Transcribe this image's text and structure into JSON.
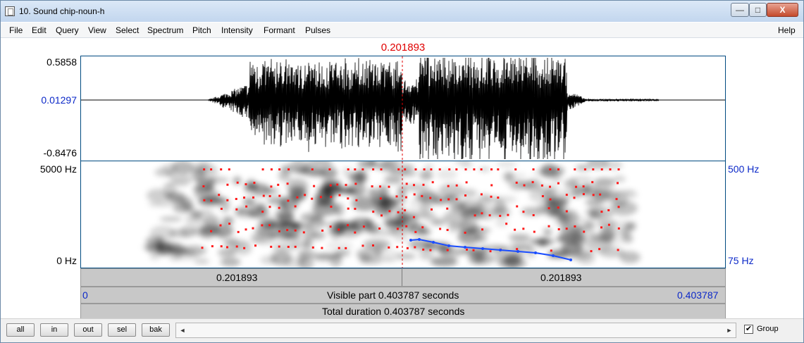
{
  "window": {
    "title": "10. Sound chip-noun-h",
    "controls": {
      "minimize": "—",
      "maximize": "□",
      "close": "X"
    }
  },
  "menu": {
    "items": [
      "File",
      "Edit",
      "Query",
      "View",
      "Select",
      "Spectrum",
      "Pitch",
      "Intensity",
      "Formant",
      "Pulses"
    ],
    "help": "Help"
  },
  "cursor": {
    "time_label": "0.201893",
    "color": "#e00000"
  },
  "waveform": {
    "y_top": "0.5858",
    "y_zero": "0.01297",
    "y_bottom": "-0.8476"
  },
  "spectrogram": {
    "left_top": "5000 Hz",
    "left_bottom": "0 Hz",
    "right_top": "500 Hz",
    "right_bottom": "75 Hz",
    "formant_color": "#ff1a1a",
    "pitch_color": "#1a4dff"
  },
  "bars": {
    "left_segment": "0.201893",
    "right_segment": "0.201893",
    "visible_start": "0",
    "visible_text": "Visible part 0.403787 seconds",
    "visible_end": "0.403787",
    "total_text": "Total duration 0.403787 seconds"
  },
  "toolbar": {
    "buttons": [
      "all",
      "in",
      "out",
      "sel",
      "bak"
    ],
    "left_arrow": "◄",
    "right_arrow": "►",
    "group_checked": "✔",
    "group_label": "Group"
  }
}
